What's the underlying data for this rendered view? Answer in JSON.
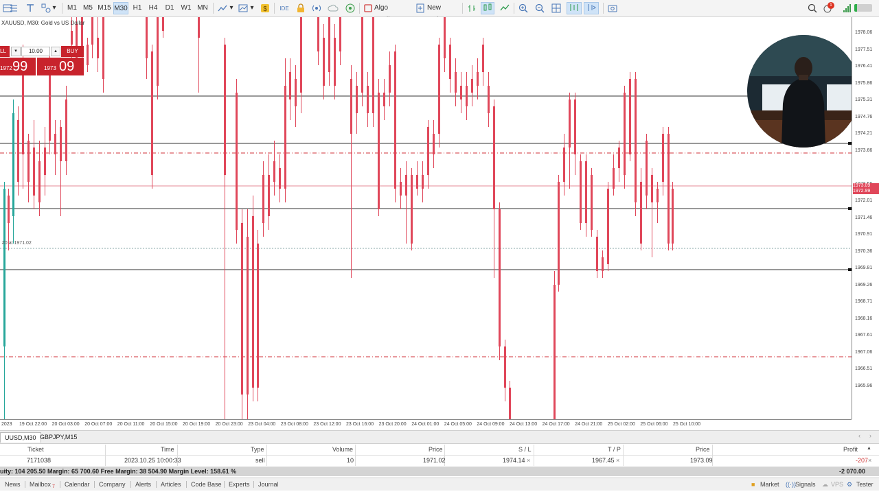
{
  "toolbar": {
    "timeframes": [
      "M1",
      "M5",
      "M15",
      "M30",
      "H1",
      "H4",
      "D1",
      "W1",
      "MN"
    ],
    "active_timeframe": "M30",
    "algo_trading_label": "Algo Trading",
    "new_order_label": "New Order",
    "notification_count": "1"
  },
  "chart": {
    "symbol_caption": "XAUUSD, M30:  Gold vs US Dollar",
    "sell_label": "LL",
    "lot_value": "10.00",
    "buy_label": "BUY",
    "sell_price_small": "1972",
    "sell_price_big": "99",
    "buy_price_small": "1973",
    "buy_price_big": "09",
    "order_line_label": "#0 at 1971.02",
    "bid_tag": "1973.09",
    "ask_tag": "1972.99",
    "colors": {
      "bull": "#26a69a",
      "bear": "#e0475a",
      "level": "#333333",
      "stop_line": "#d0303a"
    },
    "price_scale": [
      "1978.06",
      "1977.51",
      "1976.41",
      "1975.86",
      "1975.31",
      "1974.76",
      "1974.21",
      "1973.66",
      "1972.56",
      "1972.01",
      "1971.46",
      "1970.91",
      "1970.36",
      "1969.81",
      "1969.26",
      "1968.71",
      "1968.16",
      "1967.61",
      "1967.06",
      "1966.51",
      "1965.96"
    ],
    "time_scale": [
      "2023",
      "19 Oct 22:00",
      "20 Oct 03:00",
      "20 Oct 07:00",
      "20 Oct 11:00",
      "20 Oct 15:00",
      "20 Oct 19:00",
      "20 Oct 23:00",
      "23 Oct 04:00",
      "23 Oct 08:00",
      "23 Oct 12:00",
      "23 Oct 16:00",
      "23 Oct 20:00",
      "24 Oct 01:00",
      "24 Oct 05:00",
      "24 Oct 09:00",
      "24 Oct 13:00",
      "24 Oct 17:00",
      "24 Oct 21:00",
      "25 Oct 02:00",
      "25 Oct 06:00",
      "25 Oct 10:00"
    ]
  },
  "chart_tabs": [
    "UUSD,M30",
    "GBPJPY,M15"
  ],
  "trade_table": {
    "headers": {
      "ticket": "Ticket",
      "time": "Time",
      "type": "Type",
      "volume": "Volume",
      "price": "Price",
      "sl": "S / L",
      "tp": "T / P",
      "cur_price": "Price",
      "profit": "Profit"
    },
    "row": {
      "ticket": "7171038",
      "time": "2023.10.25 10:00:33",
      "type": "sell",
      "volume": "10",
      "price": "1971.02",
      "sl": "1974.14",
      "tp": "1967.45",
      "cur_price": "1973.09",
      "profit": "-207"
    },
    "close_glyph": "×",
    "summary": "uity: 104 205.50  Margin: 65 700.60  Free Margin: 38 504.90  Margin Level: 158.61 %",
    "total_profit": "-2 070.00"
  },
  "bottom_tabs": {
    "news": "News",
    "mailbox": "Mailbox",
    "mailbox_count": "7",
    "calendar": "Calendar",
    "company": "Company",
    "alerts": "Alerts",
    "articles": "Articles",
    "code_base": "Code Base",
    "experts": "Experts",
    "journal": "Journal",
    "market": "Market",
    "signals": "Signals",
    "vps": "VPS",
    "tester": "Tester"
  }
}
